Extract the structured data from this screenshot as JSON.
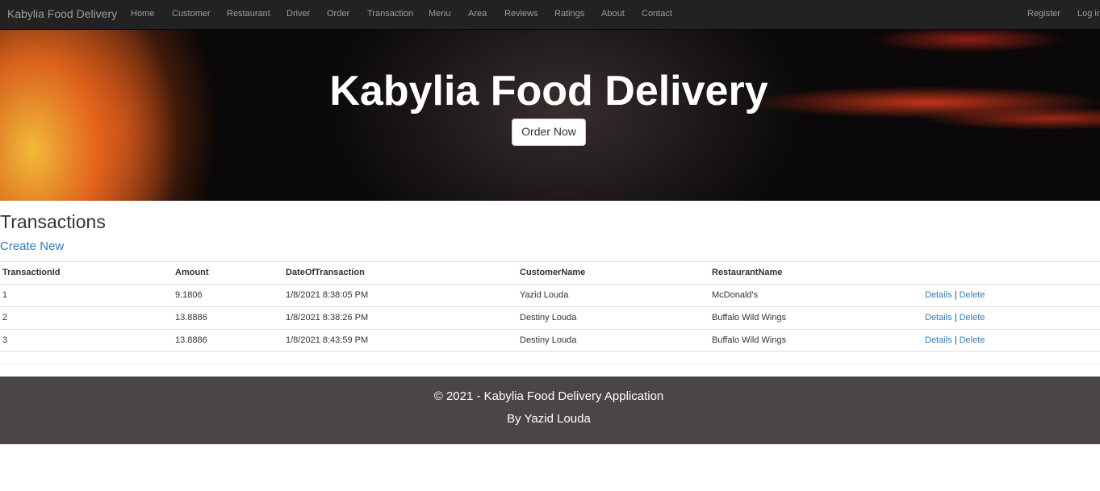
{
  "navbar": {
    "brand": "Kabylia Food Delivery",
    "links": [
      "Home",
      "Customer",
      "Restaurant",
      "Driver",
      "Order",
      "Transaction",
      "Menu",
      "Area",
      "Reviews",
      "Ratings",
      "About",
      "Contact"
    ],
    "right_links": [
      "Register",
      "Log in"
    ]
  },
  "hero": {
    "title": "Kabylia Food Delivery",
    "button_label": "Order Now"
  },
  "main": {
    "title": "Transactions",
    "create_label": "Create New",
    "columns": [
      "TransactionId",
      "Amount",
      "DateOfTransaction",
      "CustomerName",
      "RestaurantName"
    ],
    "rows": [
      {
        "id": "1",
        "amount": "9.1806",
        "date": "1/8/2021 8:38:05 PM",
        "customer": "Yazid Louda",
        "restaurant": "McDonald's"
      },
      {
        "id": "2",
        "amount": "13.8886",
        "date": "1/8/2021 8:38:26 PM",
        "customer": "Destiny Louda",
        "restaurant": "Buffalo Wild Wings"
      },
      {
        "id": "3",
        "amount": "13.8886",
        "date": "1/8/2021 8:43:59 PM",
        "customer": "Destiny Louda",
        "restaurant": "Buffalo Wild Wings"
      }
    ],
    "actions": {
      "details": "Details",
      "separator": "|",
      "delete": "Delete"
    }
  },
  "footer": {
    "line1": "© 2021 - Kabylia Food Delivery Application",
    "line2": "By Yazid Louda"
  },
  "colors": {
    "navbar_bg": "#222222",
    "link_blue": "#337ab7",
    "footer_bg": "#4a4646"
  }
}
